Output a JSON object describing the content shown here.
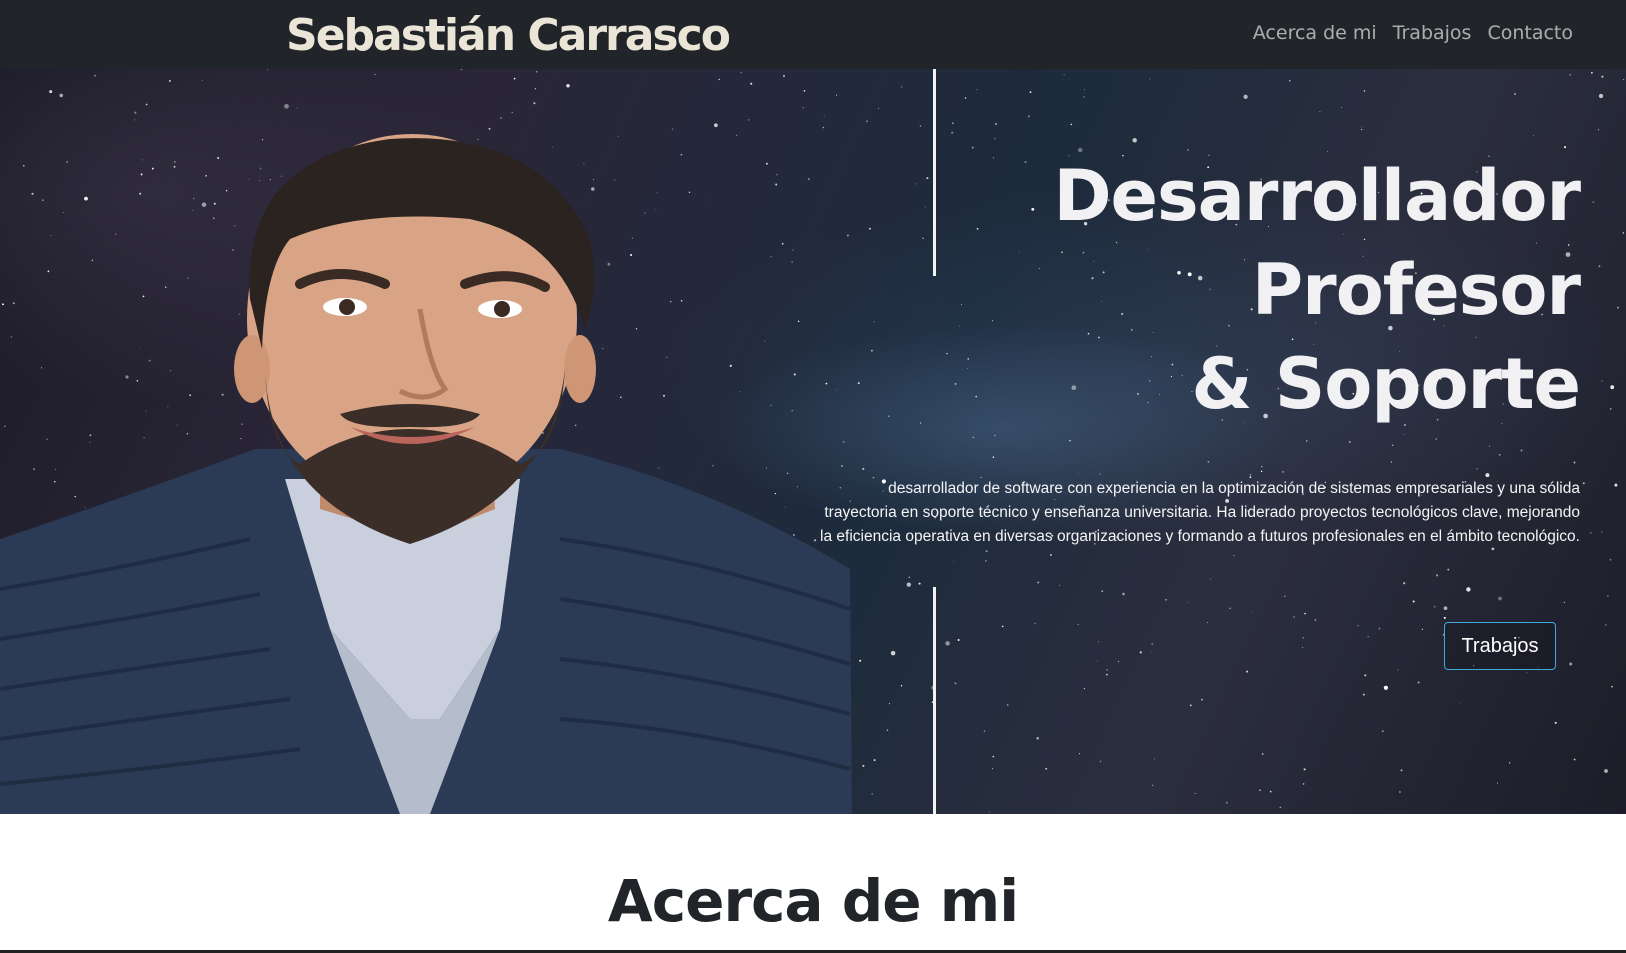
{
  "navbar": {
    "brand": "Sebastián Carrasco",
    "links": [
      "Acerca de mi",
      "Trabajos",
      "Contacto"
    ]
  },
  "hero": {
    "headline": [
      "Desarrollador",
      "Profesor",
      "& Soporte"
    ],
    "intro": "desarrollador de software con experiencia en la optimización de sistemas empresariales y una sólida trayectoria en soporte técnico y enseñanza universitaria. Ha liderado proyectos tecnológicos clave, mejorando la eficiencia operativa en diversas organizaciones y formando a futuros profesionales en el ámbito tecnológico.",
    "cta_label": "Trabajos"
  },
  "about": {
    "title": "Acerca de mi"
  },
  "colors": {
    "navbar_bg": "#212529",
    "brand_text": "#ebe5d8",
    "cta_border": "#3fa9e0",
    "heading_text": "#212529"
  }
}
